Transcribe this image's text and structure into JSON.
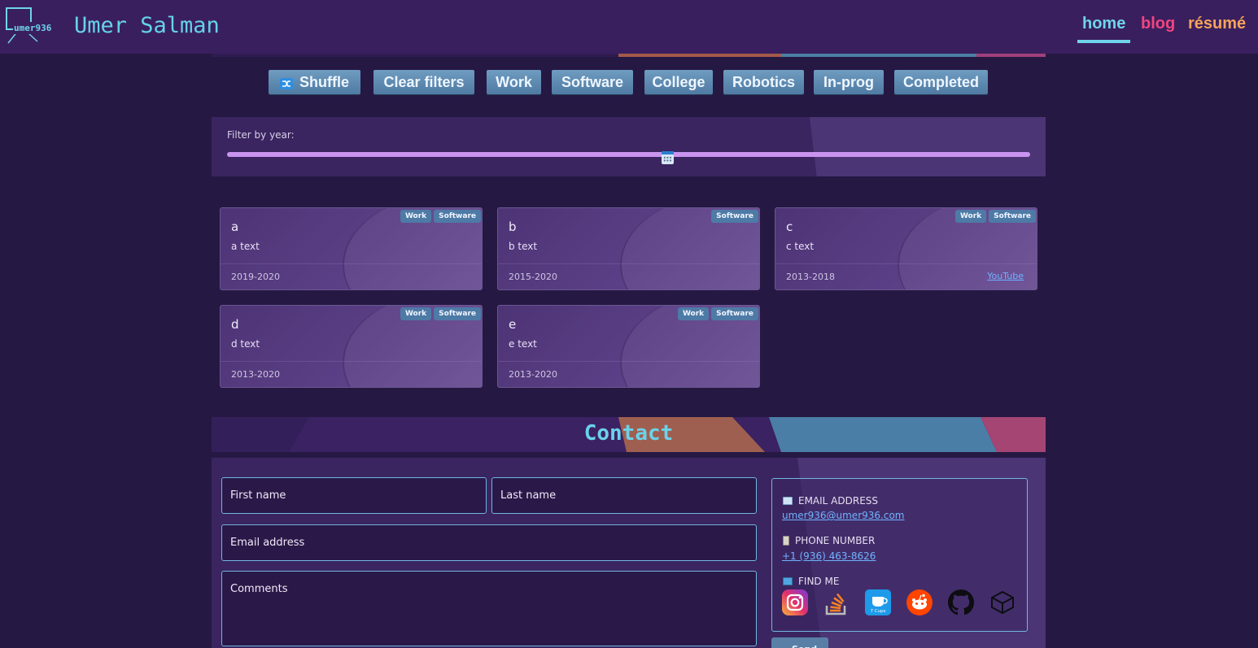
{
  "header": {
    "logo_text": "umer936",
    "title": "Umer Salman",
    "nav": {
      "home": "home",
      "blog": "blog",
      "resume": "résumé"
    }
  },
  "filters": {
    "shuffle": "Shuffle",
    "clear": "Clear filters",
    "work": "Work",
    "software": "Software",
    "college": "College",
    "robotics": "Robotics",
    "inprog": "In-prog",
    "completed": "Completed"
  },
  "year_filter": {
    "label": "Filter by year:",
    "level": 0.548
  },
  "cards": [
    {
      "title": "a",
      "text": "a text",
      "years": "2019-2020",
      "tags": [
        "Work",
        "Software"
      ]
    },
    {
      "title": "b",
      "text": "b text",
      "years": "2015-2020",
      "tags": [
        "Software"
      ]
    },
    {
      "title": "c",
      "text": "c text",
      "years": "2013-2018",
      "tags": [
        "Work",
        "Software"
      ],
      "link": "YouTube"
    },
    {
      "title": "d",
      "text": "d text",
      "years": "2013-2020",
      "tags": [
        "Work",
        "Software"
      ]
    },
    {
      "title": "e",
      "text": "e text",
      "years": "2013-2020",
      "tags": [
        "Work",
        "Software"
      ]
    }
  ],
  "contact": {
    "title": "Contact",
    "first_name": "First name",
    "last_name": "Last name",
    "email": "Email address",
    "comments": "Comments",
    "email_label": "EMAIL ADDRESS",
    "email_value": "umer936@umer936.com",
    "phone_label": "PHONE NUMBER",
    "phone_value": "+1 (936) 463-8626",
    "find_label": "FIND ME",
    "social": [
      "instagram-icon",
      "stackoverflow-icon",
      "7cups-icon",
      "reddit-icon",
      "github-icon",
      "codepen-icon"
    ],
    "cups_text": "7 Cups",
    "send": "Send"
  },
  "colors": {
    "nav_home": "#6fd4ea",
    "nav_blog": "#f0457f",
    "nav_resume": "#f5a35a",
    "button": "#5d8ab3",
    "slider": "#c994f0"
  }
}
